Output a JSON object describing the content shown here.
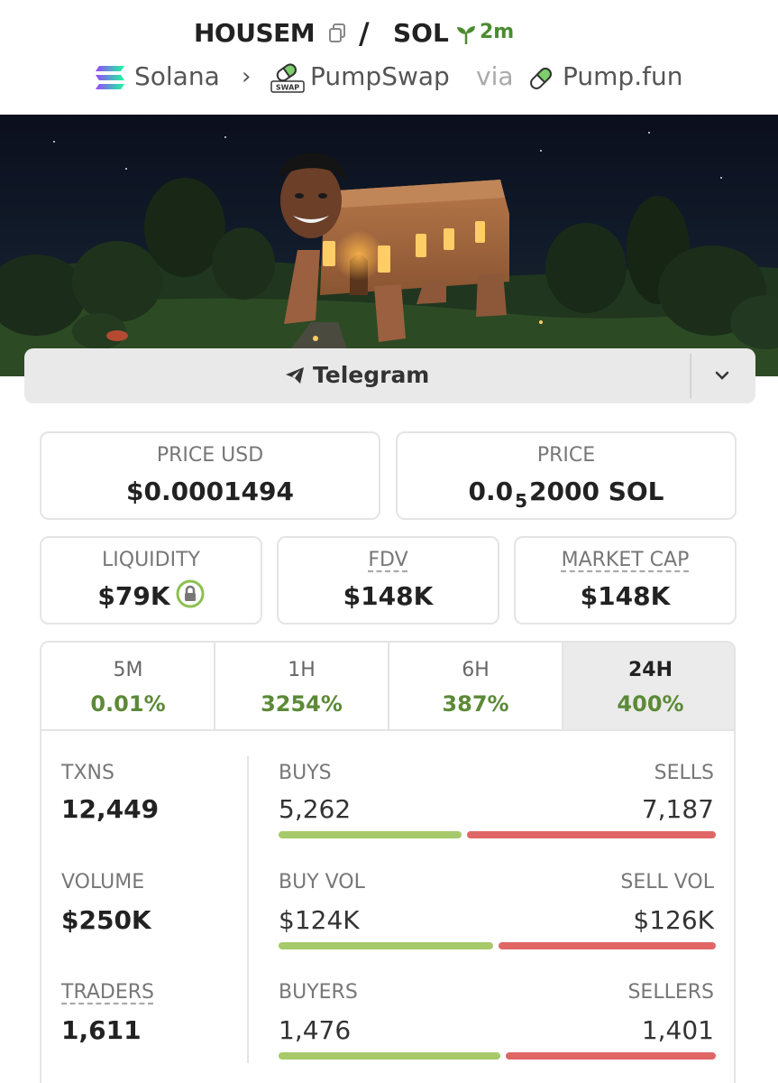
{
  "header": {
    "symbol": "HOUSEM",
    "separator": "/",
    "quote": "SOL",
    "age": "2m",
    "chain": "Solana",
    "dex": "PumpSwap",
    "via": "via",
    "launchpad": "Pump.fun",
    "swap_badge": "SWAP"
  },
  "social": {
    "telegram_label": "Telegram"
  },
  "stats": {
    "price_usd_label": "PRICE USD",
    "price_usd": "$0.0001494",
    "price_label": "PRICE",
    "price_prefix": "0.0",
    "price_sub": "5",
    "price_suffix": "2000 SOL",
    "liquidity_label": "LIQUIDITY",
    "liquidity": "$79K",
    "fdv_label": "FDV",
    "fdv": "$148K",
    "mcap_label": "MARKET CAP",
    "mcap": "$148K"
  },
  "tabs": [
    {
      "label": "5M",
      "value": "0.01%"
    },
    {
      "label": "1H",
      "value": "3254%"
    },
    {
      "label": "6H",
      "value": "387%"
    },
    {
      "label": "24H",
      "value": "400%"
    }
  ],
  "activity": {
    "txns_label": "TXNS",
    "txns": "12,449",
    "volume_label": "VOLUME",
    "volume": "$250K",
    "traders_label": "TRADERS",
    "traders": "1,611",
    "buys_label": "BUYS",
    "buys": "5,262",
    "sells_label": "SELLS",
    "sells": "7,187",
    "buy_vol_label": "BUY VOL",
    "buy_vol": "$124K",
    "sell_vol_label": "SELL VOL",
    "sell_vol": "$126K",
    "buyers_label": "BUYERS",
    "buyers": "1,476",
    "sellers_label": "SELLERS",
    "sellers": "1,401",
    "buys_fraction": 0.423,
    "buy_vol_fraction": 0.496,
    "buyers_fraction": 0.513
  },
  "colors": {
    "positive": "#5c8a37",
    "buy_bar": "#a6c96a",
    "sell_bar": "#e06666",
    "age_green": "#4b8b2f"
  }
}
